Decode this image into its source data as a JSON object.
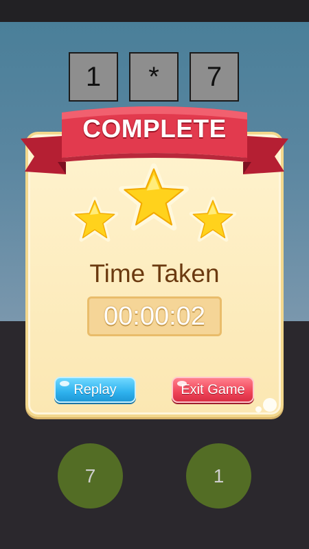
{
  "equation": {
    "left": "1",
    "operator": "*",
    "right": "7"
  },
  "result_popup": {
    "title": "COMPLETE",
    "stars_earned": 3,
    "stars_total": 3,
    "time_label": "Time Taken",
    "time_value": "00:00:02",
    "replay_label": "Replay",
    "exit_label": "Exit Game"
  },
  "answer_choices": [
    "7",
    "1"
  ],
  "colors": {
    "ribbon": "#e23a4e",
    "panel": "#fdf0c6",
    "replay_button": "#2fb2ee",
    "exit_button": "#ef4458",
    "choice_circle": "#536d25",
    "star": "#ffd21c"
  }
}
